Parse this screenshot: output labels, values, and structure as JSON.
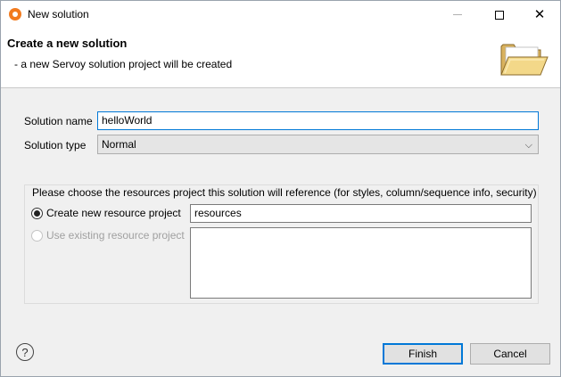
{
  "window": {
    "title": "New solution",
    "icon": "servoy-app-icon"
  },
  "header": {
    "title": "Create a new solution",
    "description": "- a new Servoy solution project will be created",
    "icon": "open-folder-icon"
  },
  "form": {
    "solution_name_label": "Solution name",
    "solution_name_value": "helloWorld",
    "solution_type_label": "Solution type",
    "solution_type_value": "Normal"
  },
  "resources": {
    "group_title": "Please choose the resources project this solution will reference (for styles, column/sequence info, security)",
    "create_new_label": "Create new resource project",
    "create_new_selected": true,
    "new_project_name": "resources",
    "use_existing_label": "Use existing resource project",
    "use_existing_enabled": false,
    "existing_projects": []
  },
  "footer": {
    "help_icon": "question-mark-icon",
    "finish_label": "Finish",
    "cancel_label": "Cancel"
  },
  "colors": {
    "accent": "#0078d7",
    "brand": "#f27b1f"
  }
}
